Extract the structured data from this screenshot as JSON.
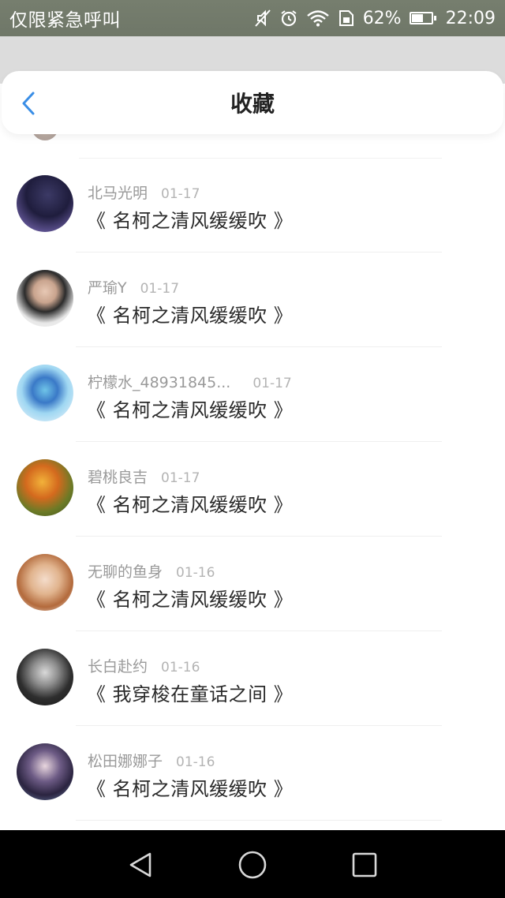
{
  "status_bar": {
    "carrier": "仅限紧急呼叫",
    "battery_percent": "62%",
    "battery_level": 0.62,
    "time": "22:09",
    "icons": [
      "mute-icon",
      "alarm-icon",
      "wifi-icon",
      "sim-icon",
      "battery-icon"
    ]
  },
  "header": {
    "title": "收藏",
    "back_icon": "chevron-left-icon",
    "accent_color": "#3a8ee6"
  },
  "favorites": [
    {
      "name": "北马光明",
      "date": "01-17",
      "title": "《 名柯之清风缓缓吹 》"
    },
    {
      "name": "严瑜Y",
      "date": "01-17",
      "title": "《 名柯之清风缓缓吹 》"
    },
    {
      "name": "柠檬水_48931845...",
      "date": "01-17",
      "title": "《 名柯之清风缓缓吹 》"
    },
    {
      "name": "碧桃良吉",
      "date": "01-17",
      "title": "《 名柯之清风缓缓吹 》"
    },
    {
      "name": "无聊的鱼身",
      "date": "01-16",
      "title": "《 名柯之清风缓缓吹 》"
    },
    {
      "name": "长白赴约",
      "date": "01-16",
      "title": "《 我穿梭在童话之间 》"
    },
    {
      "name": "松田娜娜子",
      "date": "01-16",
      "title": "《 名柯之清风缓缓吹 》"
    }
  ],
  "nav_bar": {
    "buttons": [
      "back-triangle-icon",
      "home-circle-icon",
      "recents-square-icon"
    ]
  }
}
